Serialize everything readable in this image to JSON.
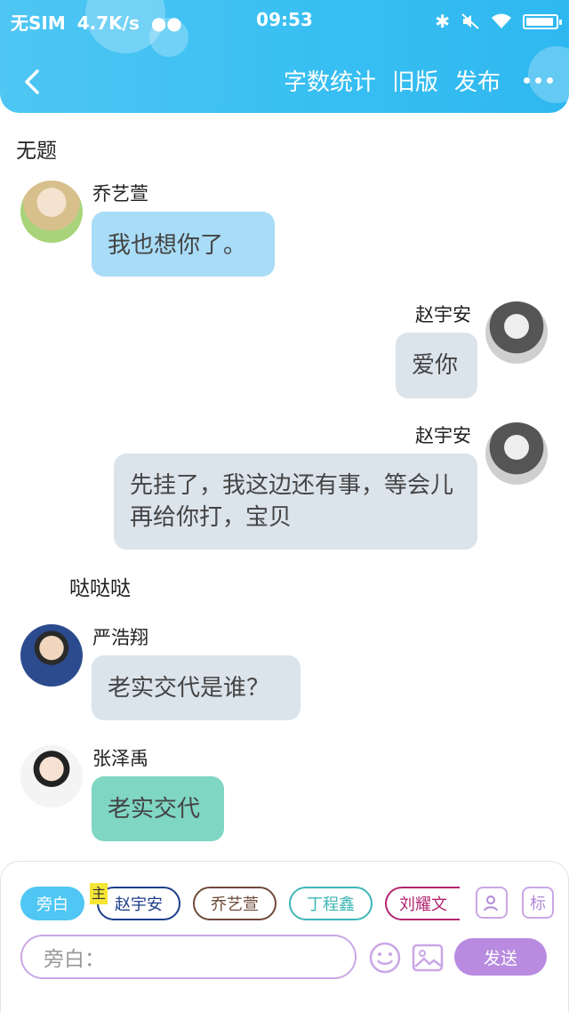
{
  "status_bar": {
    "carrier": "无SIM",
    "speed": "4.7K/s",
    "time": "09:53"
  },
  "toolbar": {
    "word_count": "字数统计",
    "old_version": "旧版",
    "publish": "发布"
  },
  "story_title": "无题",
  "messages": [
    {
      "sender": "乔艺萱",
      "text": "我也想你了。",
      "side": "left",
      "bubble_color": "#a8dcf7"
    },
    {
      "sender": "赵宇安",
      "text": "爱你",
      "side": "right",
      "bubble_color": "#dbe3eb"
    },
    {
      "sender": "赵宇安",
      "text": "先挂了，我这边还有事，等会儿再给你打，宝贝",
      "side": "right",
      "bubble_color": "#dbe3eb"
    },
    {
      "narration": "哒哒哒"
    },
    {
      "sender": "严浩翔",
      "text": "老实交代是谁？",
      "side": "left",
      "bubble_color": "#dbe3eb"
    },
    {
      "sender": "张泽禹",
      "text": "老实交代",
      "side": "left",
      "bubble_color": "#7fd6c3"
    }
  ],
  "composer": {
    "chips": [
      "旁白",
      "赵宇安",
      "乔艺萱",
      "丁程鑫",
      "刘耀文"
    ],
    "main_tag": "主",
    "label_icon_text": "标",
    "input_placeholder": "旁白：",
    "send_label": "发送"
  },
  "colors": {
    "header": "#38bff2",
    "narration_chip": "#4fc6f3",
    "send_button": "#b88be0"
  }
}
